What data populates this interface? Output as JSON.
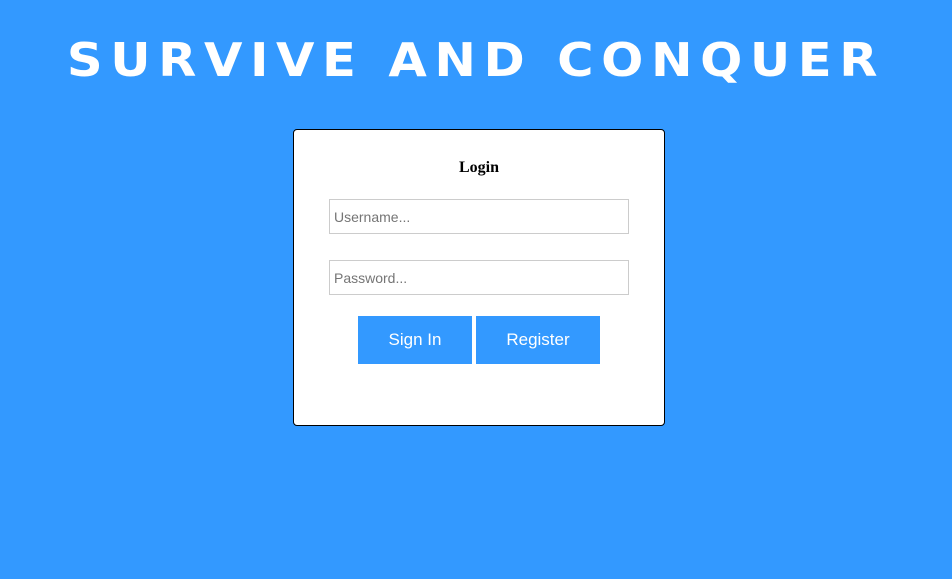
{
  "header": {
    "title": "Survive and Conquer"
  },
  "login": {
    "heading": "Login",
    "username": {
      "value": "",
      "placeholder": "Username..."
    },
    "password": {
      "value": "",
      "placeholder": "Password..."
    },
    "sign_in_label": "Sign In",
    "register_label": "Register"
  },
  "colors": {
    "background": "#3399ff",
    "button": "#3399ff",
    "card": "#ffffff"
  }
}
